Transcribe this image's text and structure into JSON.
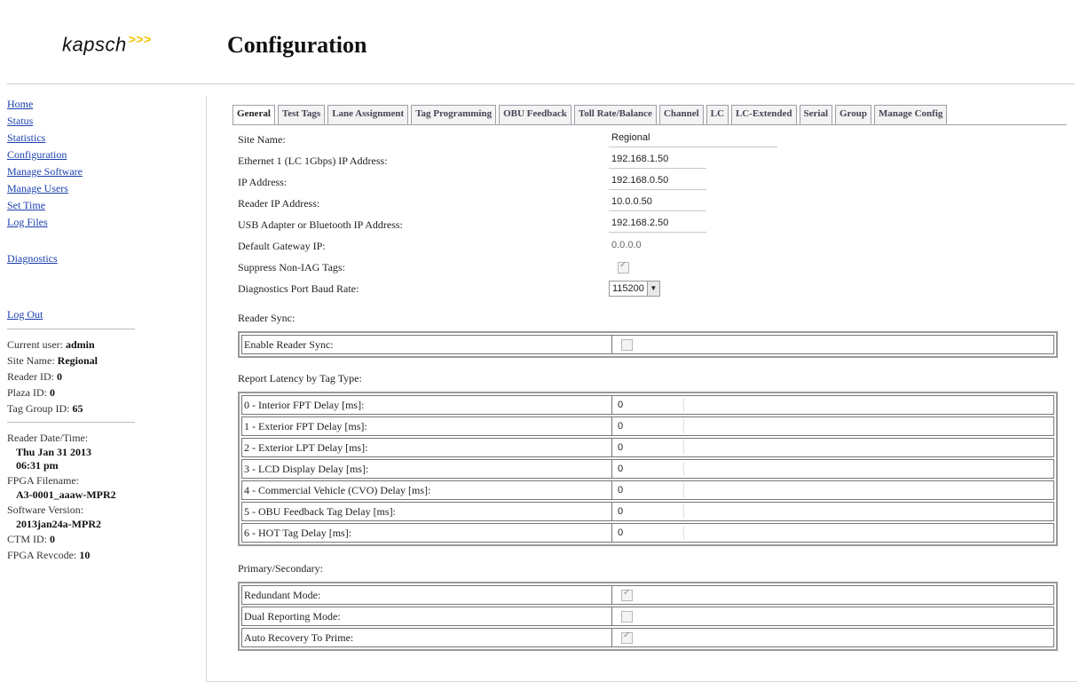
{
  "header": {
    "logo_text": "kapsch",
    "logo_arrows": ">>>",
    "title": "Configuration",
    "logo_arrow_color": "#f3c200"
  },
  "sidebar": {
    "links": [
      "Home",
      "Status",
      "Statistics",
      "Configuration",
      "Manage Software",
      "Manage Users",
      "Set Time",
      "Log Files"
    ],
    "diagnostics": "Diagnostics",
    "logout": "Log Out",
    "user_info": {
      "current_user_label": "Current user:",
      "current_user": "admin",
      "site_name_label": "Site Name:",
      "site_name": "Regional",
      "reader_id_label": "Reader ID:",
      "reader_id": "0",
      "plaza_id_label": "Plaza ID:",
      "plaza_id": "0",
      "tag_group_id_label": "Tag Group ID:",
      "tag_group_id": "65"
    },
    "reader_info": {
      "date_time_label": "Reader Date/Time:",
      "date": "Thu Jan 31 2013",
      "time": "06:31 pm",
      "fpga_filename_label": "FPGA Filename:",
      "fpga_filename": "A3-0001_aaaw-MPR2",
      "software_version_label": "Software Version:",
      "software_version": "2013jan24a-MPR2",
      "ctm_id_label": "CTM ID:",
      "ctm_id": "0",
      "fpga_revcode_label": "FPGA Revcode:",
      "fpga_revcode": "10"
    }
  },
  "tabs": [
    "General",
    "Test Tags",
    "Lane Assignment",
    "Tag Programming",
    "OBU Feedback",
    "Toll Rate/Balance",
    "Channel",
    "LC",
    "LC-Extended",
    "Serial",
    "Group",
    "Manage Config"
  ],
  "active_tab": "General",
  "general": {
    "site_name_label": "Site Name:",
    "site_name": "Regional",
    "eth1_label": "Ethernet 1 (LC 1Gbps) IP Address:",
    "eth1": "192.168.1.50",
    "ip_label": "IP Address:",
    "ip": "192.168.0.50",
    "reader_ip_label": "Reader IP Address:",
    "reader_ip": "10.0.0.50",
    "usb_label": "USB Adapter or Bluetooth IP Address:",
    "usb": "192.168.2.50",
    "gateway_label": "Default Gateway IP:",
    "gateway": "0.0.0.0",
    "suppress_label": "Suppress Non-IAG Tags:",
    "suppress_checked": true,
    "baud_label": "Diagnostics Port Baud Rate:",
    "baud": "115200"
  },
  "reader_sync": {
    "title": "Reader Sync:",
    "enable_label": "Enable Reader Sync:",
    "enable_checked": false
  },
  "latency": {
    "title": "Report Latency by Tag Type:",
    "rows": [
      {
        "label": "0 - Interior FPT Delay [ms]:",
        "value": "0"
      },
      {
        "label": "1 - Exterior FPT Delay [ms]:",
        "value": "0"
      },
      {
        "label": "2 - Exterior LPT Delay [ms]:",
        "value": "0"
      },
      {
        "label": "3 - LCD Display Delay [ms]:",
        "value": "0"
      },
      {
        "label": "4 - Commercial Vehicle (CVO) Delay [ms]:",
        "value": "0"
      },
      {
        "label": "5 - OBU Feedback Tag Delay [ms]:",
        "value": "0"
      },
      {
        "label": "6 - HOT Tag Delay [ms]:",
        "value": "0"
      }
    ]
  },
  "primary_secondary": {
    "title": "Primary/Secondary:",
    "redundant_label": "Redundant Mode:",
    "redundant_checked": true,
    "dual_label": "Dual Reporting Mode:",
    "dual_checked": false,
    "auto_label": "Auto Recovery To Prime:",
    "auto_checked": true
  }
}
